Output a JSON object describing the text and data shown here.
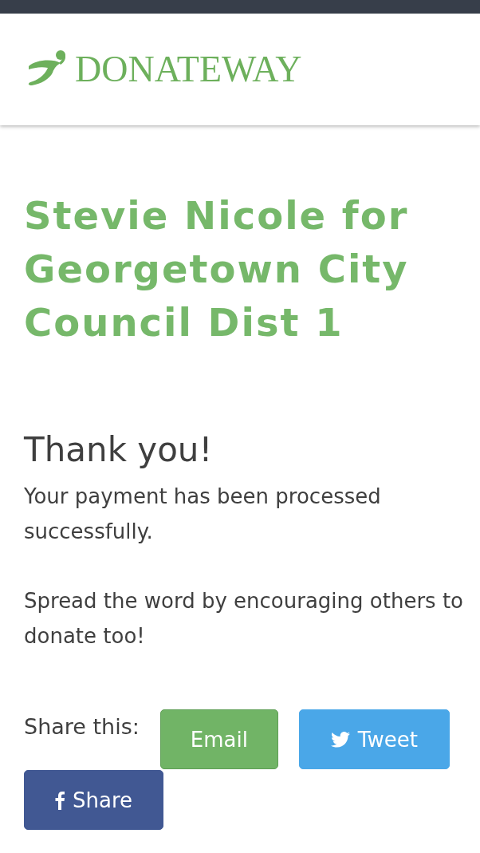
{
  "header": {
    "logo": "DONATEWAY"
  },
  "campaign": {
    "title": "Stevie Nicole for Georgetown City Council Dist 1"
  },
  "confirmation": {
    "heading": "Thank you!",
    "message": "Your payment has been processed successfully.",
    "prompt": "Spread the word by encouraging others to donate too!"
  },
  "share": {
    "label": "Share this:",
    "buttons": [
      {
        "kind": "email",
        "label": "Email"
      },
      {
        "kind": "twitter",
        "label": "Tweet"
      },
      {
        "kind": "facebook",
        "label": "Share"
      }
    ]
  }
}
